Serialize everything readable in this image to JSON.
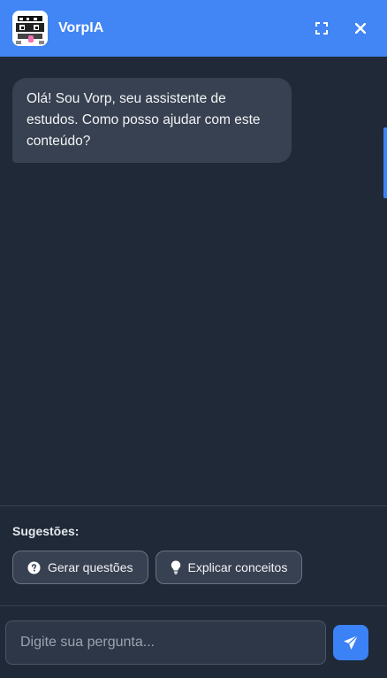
{
  "header": {
    "title": "VorpIA",
    "avatar_icon": "robot-avatar-icon",
    "expand_icon": "expand-icon",
    "close_icon": "close-icon",
    "bg_color": "#4285f4"
  },
  "messages": [
    {
      "role": "assistant",
      "text": "Olá! Sou Vorp, seu assistente de estudos. Como posso ajudar com este conteúdo?"
    }
  ],
  "suggestions": {
    "title": "Sugestões:",
    "items": [
      {
        "label": "Gerar questões",
        "icon": "question-circle-icon"
      },
      {
        "label": "Explicar conceitos",
        "icon": "lightbulb-icon"
      }
    ]
  },
  "composer": {
    "placeholder": "Digite sua pergunta...",
    "send_icon": "send-icon",
    "accent_color": "#3b82f6"
  }
}
